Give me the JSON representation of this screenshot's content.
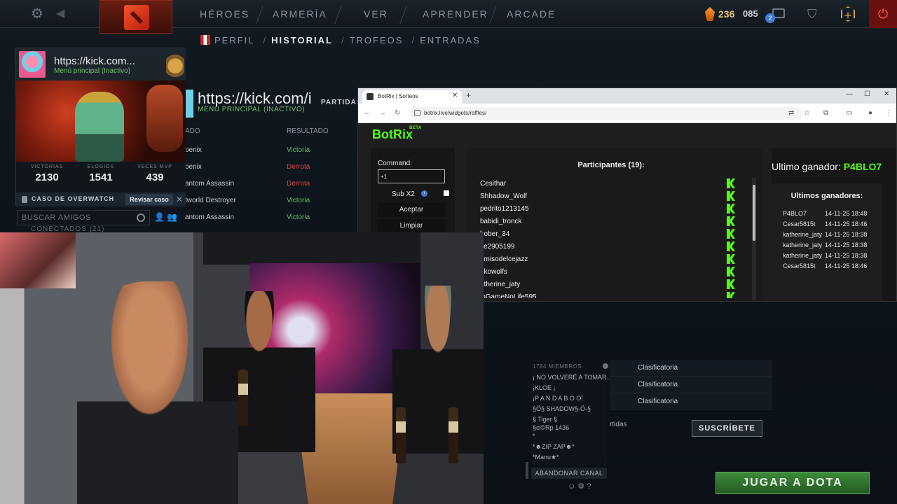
{
  "top_nav": {
    "items": [
      "HÉROES",
      "ARMERÍA",
      "VER",
      "APRENDER",
      "ARCADE"
    ],
    "shards": "236",
    "other_value": "085",
    "notification_count": "2"
  },
  "sub_nav": {
    "items": [
      "PERFIL",
      "HISTORIAL",
      "TROFEOS",
      "ENTRADAS"
    ],
    "active": "HISTORIAL"
  },
  "profile_card": {
    "name": "https://kick.com...",
    "status": "Menú principal (Inactivo)",
    "stats": [
      {
        "label": "VICTORIAS",
        "value": "2130"
      },
      {
        "label": "ELOGIOS",
        "value": "1541"
      },
      {
        "label": "VECES MVP",
        "value": "439"
      }
    ],
    "overwatch_label": "CASO DE OVERWATCH",
    "overwatch_button": "Revisar caso"
  },
  "friends": {
    "search_placeholder": "BUSCAR AMIGOS",
    "count_label": "CONECTADOS (21)"
  },
  "profile_bg": {
    "title": "https://kick.com/i",
    "subtitle": "MENÚ PRINCIPAL (INACTIVO)",
    "partidas_label": "PARTIDAS"
  },
  "match_history": {
    "headers": [
      "ADO",
      "RESULTADO"
    ],
    "rows": [
      {
        "hero": "oenix",
        "result": "Victoria"
      },
      {
        "hero": "oenix",
        "result": "Derrota"
      },
      {
        "hero": "antom Assassin",
        "result": "Derrota"
      },
      {
        "hero": "tworld Destroyer",
        "result": "Victoria"
      },
      {
        "hero": "antom Assassin",
        "result": "Victoria"
      }
    ]
  },
  "browser": {
    "tab_title": "BotRix | Sorteos",
    "url": "botrix.live/widgets/raffles/"
  },
  "botrix": {
    "logo": "BotRix",
    "beta": "BETA",
    "command_label": "Command:",
    "command_value": "+1",
    "sub_label": "Sub X2",
    "accept_label": "Aceptar",
    "clear_label": "Limpiar",
    "participants_title": "Participantes (19):",
    "participants": [
      "Cesithar",
      "Shhadow_Wolf",
      "pedrito1213145",
      "babidi_tronck",
      "hober_34",
      "xe2905199",
      "umisodelcejazz",
      "okowolfs",
      "atherine_jaty",
      "loGameNoLife595"
    ],
    "last_winner_label": "Ultimo ganador: ",
    "last_winner": "P4BLO7",
    "winners_title": "Ultimos ganadores:",
    "winners": [
      {
        "name": "P4BLO7",
        "date": "14-11-25 18:48"
      },
      {
        "name": "Cesar5815t",
        "date": "14-11-25 18:46"
      },
      {
        "name": "katherine_jaty",
        "date": "14-11-25 18:38"
      },
      {
        "name": "katherine_jaty",
        "date": "14-11-25 18:38"
      },
      {
        "name": "katherine_jaty",
        "date": "14-11-25 18:38"
      },
      {
        "name": "Cesar5815t",
        "date": "14-11-25 18:46"
      }
    ]
  },
  "channel": {
    "members": "1784 MIEMBROS",
    "names": [
      "¡ NO VOLVERÉ A TOMAR...",
      "¡KLOE ¡",
      "¡P A N D A B O O!",
      "§Ö§ SHADOW§-Ö-§",
      "§ Tiger §",
      "§cl©Rp 1436",
      "*",
      "*☻ZIP ZAP☻*",
      "*Manu★*"
    ],
    "leave_label": "ABANDONAR CANAL"
  },
  "ranked_rows": [
    "Clasificatoria",
    "Clasificatoria",
    "Clasificatoria"
  ],
  "partidas_label2": "rtidas",
  "subscribe_label": "SUSCRÍBETE",
  "play_label": "JUGAR A DOTA"
}
